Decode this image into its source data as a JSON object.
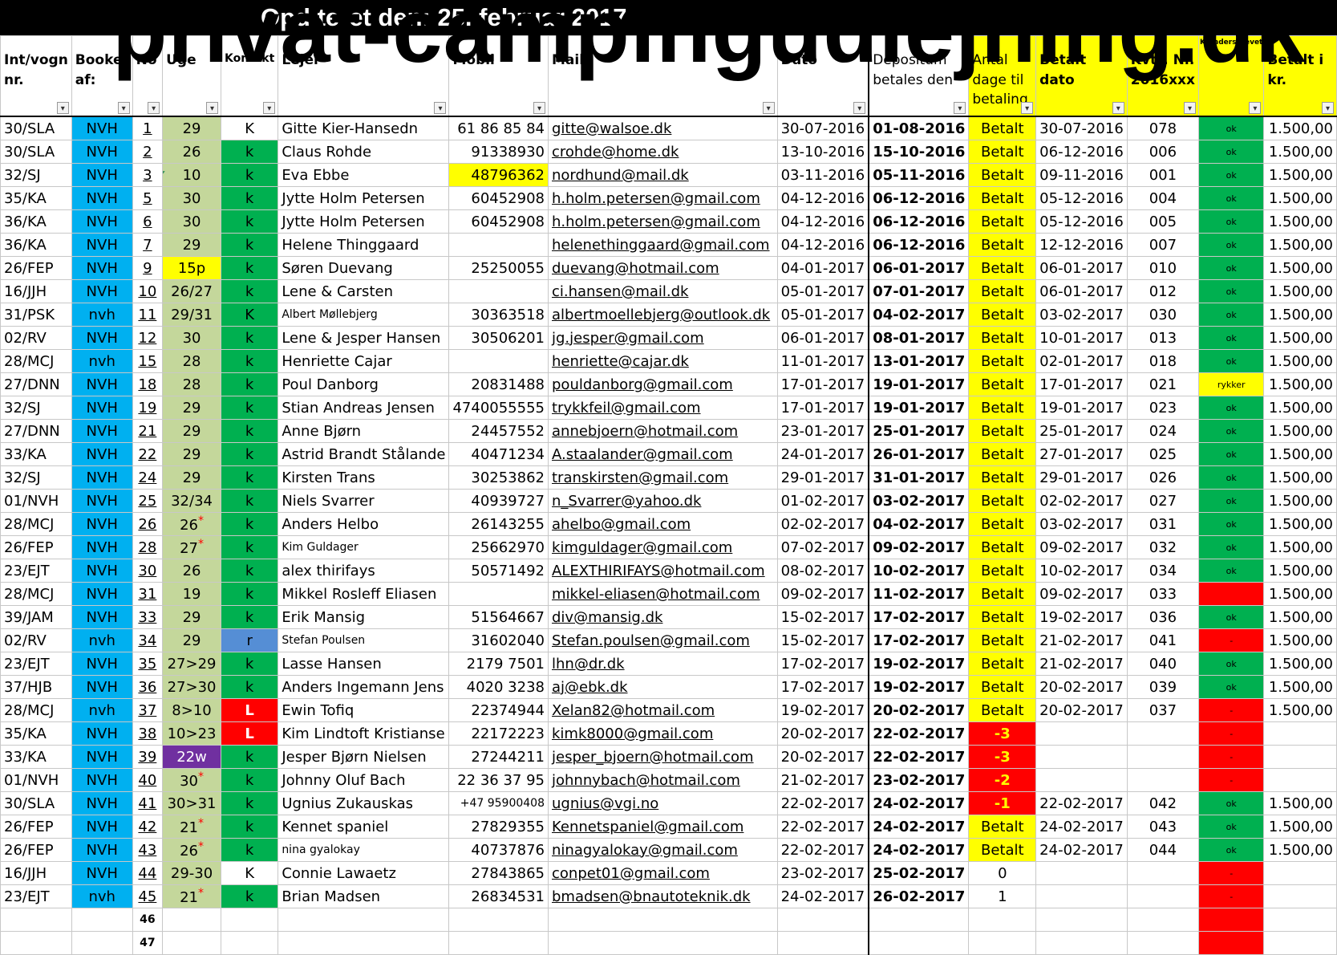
{
  "header": {
    "updated": "Opd  teret den:  25. februar 2017",
    "watermark": "privat-campingudlejning.dk"
  },
  "columns": [
    "Int/vogn nr.",
    "Booket af:",
    "No",
    "Uge",
    "Kontakt",
    "Lejer",
    "Mobil",
    "Mail",
    "Dato",
    "Depositum betales den",
    "Antal dage til betaling",
    "Betalt dato",
    "Kvtt. Nr. 2016xxx",
    "K.underskrevet",
    "Betalt i kr."
  ],
  "rows": [
    [
      "30/SLA",
      "NVH",
      "1",
      "29",
      "K",
      "Gitte Kier-Hansedn",
      "61 86 85 84",
      "gitte@walsoe.dk",
      "30-07-2016",
      "01-08-2016",
      "Betalt",
      "30-07-2016",
      "078",
      "ok",
      "1.500,00"
    ],
    [
      "30/SLA",
      "NVH",
      "2",
      "26",
      "k",
      "Claus Rohde",
      "91338930",
      "crohde@home.dk",
      "13-10-2016",
      "15-10-2016",
      "Betalt",
      "06-12-2016",
      "006",
      "ok",
      "1.500,00"
    ],
    [
      "32/SJ",
      "NVH",
      "3",
      "10",
      "k",
      "Eva Ebbe",
      "48796362",
      "nordhund@mail.dk",
      "03-11-2016",
      "05-11-2016",
      "Betalt",
      "09-11-2016",
      "001",
      "ok",
      "1.500,00"
    ],
    [
      "35/KA",
      "NVH",
      "5",
      "30",
      "k",
      "Jytte Holm Petersen",
      "60452908",
      "h.holm.petersen@gmail.com",
      "04-12-2016",
      "06-12-2016",
      "Betalt",
      "05-12-2016",
      "004",
      "ok",
      "1.500,00"
    ],
    [
      "36/KA",
      "NVH",
      "6",
      "30",
      "k",
      "Jytte Holm Petersen",
      "60452908",
      "h.holm.petersen@gmail.com",
      "04-12-2016",
      "06-12-2016",
      "Betalt",
      "05-12-2016",
      "005",
      "ok",
      "1.500,00"
    ],
    [
      "36/KA",
      "NVH",
      "7",
      "29",
      "k",
      "Helene Thinggaard",
      "",
      "helenethinggaard@gmail.com",
      "04-12-2016",
      "06-12-2016",
      "Betalt",
      "12-12-2016",
      "007",
      "ok",
      "1.500,00"
    ],
    [
      "26/FEP",
      "NVH",
      "9",
      "15p",
      "k",
      "Søren Duevang",
      "25250055",
      "duevang@hotmail.com",
      "04-01-2017",
      "06-01-2017",
      "Betalt",
      "06-01-2017",
      "010",
      "ok",
      "1.500,00"
    ],
    [
      "16/JJH",
      "NVH",
      "10",
      "26/27",
      "k",
      "Lene & Carsten",
      "",
      "ci.hansen@mail.dk",
      "05-01-2017",
      "07-01-2017",
      "Betalt",
      "06-01-2017",
      "012",
      "ok",
      "1.500,00"
    ],
    [
      "31/PSK",
      "nvh",
      "11",
      "29/31",
      "K",
      "Albert Møllebjerg",
      "30363518",
      "albertmoellebjerg@outlook.dk",
      "05-01-2017",
      "04-02-2017",
      "Betalt",
      "03-02-2017",
      "030",
      "ok",
      "1.500,00"
    ],
    [
      "02/RV",
      "NVH",
      "12",
      "30",
      "k",
      "Lene & Jesper Hansen",
      "30506201",
      "jg.jesper@gmail.com",
      "06-01-2017",
      "08-01-2017",
      "Betalt",
      "10-01-2017",
      "013",
      "ok",
      "1.500,00"
    ],
    [
      "28/MCJ",
      "nvh",
      "15",
      "28",
      "k",
      "Henriette Cajar",
      "",
      "henriette@cajar.dk",
      "11-01-2017",
      "13-01-2017",
      "Betalt",
      "02-01-2017",
      "018",
      "ok",
      "1.500,00"
    ],
    [
      "27/DNN",
      "NVH",
      "18",
      "28",
      "k",
      "Poul Danborg",
      "20831488",
      "pouldanborg@gmail.com",
      "17-01-2017",
      "19-01-2017",
      "Betalt",
      "17-01-2017",
      "021",
      "rykker",
      "1.500,00"
    ],
    [
      "32/SJ",
      "NVH",
      "19",
      "29",
      "k",
      "Stian Andreas Jensen",
      "4740055555",
      "trykkfeil@gmail.com",
      "17-01-2017",
      "19-01-2017",
      "Betalt",
      "19-01-2017",
      "023",
      "ok",
      "1.500,00"
    ],
    [
      "27/DNN",
      "NVH",
      "21",
      "29",
      "k",
      "Anne Bjørn",
      "24457552",
      "annebjoern@hotmail.com",
      "23-01-2017",
      "25-01-2017",
      "Betalt",
      "25-01-2017",
      "024",
      "ok",
      "1.500,00"
    ],
    [
      "33/KA",
      "NVH",
      "22",
      "29",
      "k",
      "Astrid Brandt Stålande",
      "40471234",
      "A.staalander@gmail.com",
      "24-01-2017",
      "26-01-2017",
      "Betalt",
      "27-01-2017",
      "025",
      "ok",
      "1.500,00"
    ],
    [
      "32/SJ",
      "NVH",
      "24",
      "29",
      "k",
      "Kirsten Trans",
      "30253862",
      "transkirsten@gmail.com",
      "29-01-2017",
      "31-01-2017",
      "Betalt",
      "29-01-2017",
      "026",
      "ok",
      "1.500,00"
    ],
    [
      "01/NVH",
      "NVH",
      "25",
      "32/34",
      "k",
      "Niels Svarrer",
      "40939727",
      "n_Svarrer@yahoo.dk",
      "01-02-2017",
      "03-02-2017",
      "Betalt",
      "02-02-2017",
      "027",
      "ok",
      "1.500,00"
    ],
    [
      "28/MCJ",
      "NVH",
      "26",
      "26*",
      "k",
      "Anders Helbo",
      "26143255",
      "ahelbo@gmail.com",
      "02-02-2017",
      "04-02-2017",
      "Betalt",
      "03-02-2017",
      "031",
      "ok",
      "1.500,00"
    ],
    [
      "26/FEP",
      "NVH",
      "28",
      "27*",
      "k",
      "Kim Guldager",
      "25662970",
      "kimguldager@gmail.com",
      "07-02-2017",
      "09-02-2017",
      "Betalt",
      "09-02-2017",
      "032",
      "ok",
      "1.500,00"
    ],
    [
      "23/EJT",
      "NVH",
      "30",
      "26",
      "k",
      "alex thirifays",
      "50571492",
      "ALEXTHIRIFAYS@hotmail.com",
      "08-02-2017",
      "10-02-2017",
      "Betalt",
      "10-02-2017",
      "034",
      "ok",
      "1.500,00"
    ],
    [
      "28/MCJ",
      "NVH",
      "31",
      "19",
      "k",
      "Mikkel Rosleff Eliasen",
      "",
      "mikkel-eliasen@hotmail.com",
      "09-02-2017",
      "11-02-2017",
      "Betalt",
      "09-02-2017",
      "033",
      "",
      "1.500,00"
    ],
    [
      "39/JAM",
      "NVH",
      "33",
      "29",
      "k",
      "Erik Mansig",
      "51564667",
      "div@mansig.dk",
      "15-02-2017",
      "17-02-2017",
      "Betalt",
      "19-02-2017",
      "036",
      "ok",
      "1.500,00"
    ],
    [
      "02/RV",
      "nvh",
      "34",
      "29",
      "r",
      "Stefan Poulsen",
      "31602040",
      "Stefan.poulsen@gmail.com",
      "15-02-2017",
      "17-02-2017",
      "Betalt",
      "21-02-2017",
      "041",
      "-",
      "1.500,00"
    ],
    [
      "23/EJT",
      "NVH",
      "35",
      "27>29",
      "k",
      "Lasse Hansen",
      "2179 7501",
      "lhn@dr.dk",
      "17-02-2017",
      "19-02-2017",
      "Betalt",
      "21-02-2017",
      "040",
      "ok",
      "1.500,00"
    ],
    [
      "37/HJB",
      "NVH",
      "36",
      "27>30",
      "k",
      "Anders Ingemann Jens",
      "4020 3238",
      "aj@ebk.dk",
      "17-02-2017",
      "19-02-2017",
      "Betalt",
      "20-02-2017",
      "039",
      "ok",
      "1.500,00"
    ],
    [
      "28/MCJ",
      "nvh",
      "37",
      "8>10",
      "L",
      "Ewin Tofiq",
      "22374944",
      "Xelan82@hotmail.com",
      "19-02-2017",
      "20-02-2017",
      "Betalt",
      "20-02-2017",
      "037",
      "-",
      "1.500,00"
    ],
    [
      "35/KA",
      "NVH",
      "38",
      "10>23",
      "L",
      "Kim Lindtoft Kristianse",
      "22172223",
      "kimk8000@gmail.com",
      "20-02-2017",
      "22-02-2017",
      "-3",
      "",
      "",
      "-",
      ""
    ],
    [
      "33/KA",
      "NVH",
      "39",
      "22w",
      "k",
      "Jesper Bjørn Nielsen",
      "27244211",
      "jesper_bjoern@hotmail.com",
      "20-02-2017",
      "22-02-2017",
      "-3",
      "",
      "",
      "-",
      ""
    ],
    [
      "01/NVH",
      "NVH",
      "40",
      "30*",
      "k",
      "Johnny Oluf Bach",
      "22 36 37 95",
      "johnnybach@hotmail.com",
      "21-02-2017",
      "23-02-2017",
      "-2",
      "",
      "",
      "-",
      ""
    ],
    [
      "30/SLA",
      "NVH",
      "41",
      "30>31",
      "k",
      "Ugnius Zukauskas",
      "+47 95900408",
      "ugnius@vgi.no",
      "22-02-2017",
      "24-02-2017",
      "-1",
      "22-02-2017",
      "042",
      "ok",
      "1.500,00"
    ],
    [
      "26/FEP",
      "NVH",
      "42",
      "21*",
      "k",
      "Kennet spaniel",
      "27829355",
      "Kennetspaniel@gmail.com",
      "22-02-2017",
      "24-02-2017",
      "Betalt",
      "24-02-2017",
      "043",
      "ok",
      "1.500,00"
    ],
    [
      "26/FEP",
      "NVH",
      "43",
      "26*",
      "k",
      "nina gyalokay",
      "40737876",
      "ninagyalokay@gmail.com",
      "22-02-2017",
      "24-02-2017",
      "Betalt",
      "24-02-2017",
      "044",
      "ok",
      "1.500,00"
    ],
    [
      "16/JJH",
      "NVH",
      "44",
      "29-30",
      "K",
      "Connie Lawaetz",
      "27843865",
      "conpet01@gmail.com",
      "23-02-2017",
      "25-02-2017",
      "0",
      "",
      "",
      "-",
      ""
    ],
    [
      "23/EJT",
      "nvh",
      "45",
      "21*",
      "k",
      "Brian Madsen",
      "26834531",
      "bmadsen@bnautoteknik.dk",
      "24-02-2017",
      "26-02-2017",
      "1",
      "",
      "",
      "-",
      ""
    ],
    [
      "",
      "",
      "46",
      "",
      "",
      "",
      "",
      "",
      "",
      "",
      "",
      "",
      "",
      "",
      ""
    ],
    [
      "",
      "",
      "47",
      "",
      "",
      "",
      "",
      "",
      "",
      "",
      "",
      "",
      "",
      "",
      ""
    ]
  ],
  "colors": {
    "booked_blue": "#00b0f0",
    "contact_green": "#00b050",
    "week_green": "#c4d79b",
    "highlight_yellow": "#ffff00",
    "alert_red": "#ff0000",
    "purple": "#7030a0",
    "blue_r": "#558ed5"
  },
  "icons": {
    "checkmark": "check-icon",
    "filter": "filter-dropdown-icon"
  }
}
